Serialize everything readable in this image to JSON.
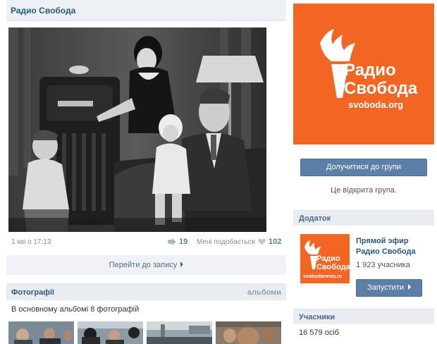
{
  "post": {
    "title": "Радио Свобода",
    "date": "1 кві о 17:13",
    "reposts": "19",
    "likes_label": "Мені подобається",
    "likes": "102",
    "goto_label": "Перейти до запису"
  },
  "photos": {
    "title": "Фотографії",
    "albums_link": "альбоми",
    "count_text": "В основному альбомі 8 фотографій"
  },
  "group": {
    "logo_name_line1": "Радио",
    "logo_name_line2": "Свобода",
    "logo_domain": "svoboda.org",
    "join_label": "Долучитися до групи",
    "open_text": "Це відкрита група."
  },
  "app": {
    "section_title": "Додаток",
    "icon_line1": "Радио",
    "icon_line2": "Свобода",
    "icon_domain": "svobodanews.ru",
    "name": "Прямой эфир Радио Свобода",
    "members": "1 923 учасника",
    "launch_label": "Запустити"
  },
  "members": {
    "section_title": "Учасники",
    "count": "16 579 осіб"
  },
  "colors": {
    "brand_orange": "#f26522",
    "link_blue": "#2b587a",
    "button_blue": "#5b7fa6"
  },
  "icons": [
    "repost-icon",
    "heart-icon",
    "torch-logo-icon"
  ]
}
